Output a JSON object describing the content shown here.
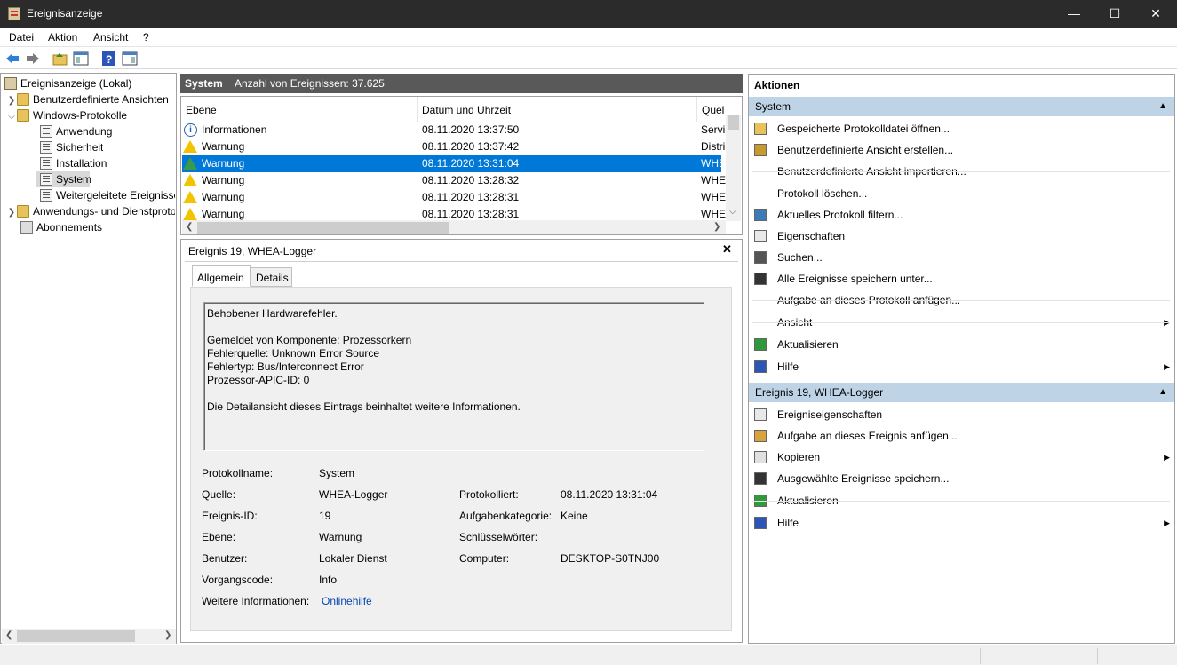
{
  "window": {
    "title": "Ereignisanzeige",
    "minimize": "—",
    "maximize": "☐",
    "close": "✕"
  },
  "menu": [
    "Datei",
    "Aktion",
    "Ansicht",
    "?"
  ],
  "tree": {
    "root": "Ereignisanzeige (Lokal)",
    "custom_views": "Benutzerdefinierte Ansichten",
    "windows_logs": "Windows-Protokolle",
    "logs": [
      "Anwendung",
      "Sicherheit",
      "Installation",
      "System",
      "Weitergeleitete Ereignisse"
    ],
    "app_service_logs": "Anwendungs- und Dienstprotokolle",
    "subscriptions": "Abonnements"
  },
  "list": {
    "header_title": "System",
    "header_count": "Anzahl von Ereignissen: 37.625",
    "columns": [
      "Ebene",
      "Datum und Uhrzeit",
      "Quel"
    ],
    "rows": [
      {
        "level": "Informationen",
        "icon": "info-icon",
        "date": "08.11.2020 13:37:50",
        "source": "Servi"
      },
      {
        "level": "Warnung",
        "icon": "warning-icon",
        "date": "08.11.2020 13:37:42",
        "source": "Distri"
      },
      {
        "level": "Warnung",
        "icon": "warning-icon",
        "date": "08.11.2020 13:31:04",
        "source": "WHE"
      },
      {
        "level": "Warnung",
        "icon": "warning-icon",
        "date": "08.11.2020 13:28:32",
        "source": "WHE"
      },
      {
        "level": "Warnung",
        "icon": "warning-icon",
        "date": "08.11.2020 13:28:31",
        "source": "WHE"
      },
      {
        "level": "Warnung",
        "icon": "warning-icon",
        "date": "08.11.2020 13:28:31",
        "source": "WHE"
      }
    ],
    "selected_index": 2
  },
  "detail": {
    "title": "Ereignis 19, WHEA-Logger",
    "close": "✕",
    "tabs": [
      "Allgemein",
      "Details"
    ],
    "message": "Behobener Hardwarefehler.\n\nGemeldet von Komponente: Prozessorkern\nFehlerquelle: Unknown Error Source\nFehlertyp: Bus/Interconnect Error\nProzessor-APIC-ID: 0\n\nDie Detailansicht dieses Eintrags beinhaltet weitere Informationen.",
    "fields": {
      "protokollname_label": "Protokollname:",
      "protokollname": "System",
      "quelle_label": "Quelle:",
      "quelle": "WHEA-Logger",
      "protokolliert_label": "Protokolliert:",
      "protokolliert": "08.11.2020 13:31:04",
      "ereignis_id_label": "Ereignis-ID:",
      "ereignis_id": "19",
      "aufgabenkategorie_label": "Aufgabenkategorie:",
      "aufgabenkategorie": "Keine",
      "ebene_label": "Ebene:",
      "ebene": "Warnung",
      "schluesselwoerter_label": "Schlüsselwörter:",
      "benutzer_label": "Benutzer:",
      "benutzer": "Lokaler Dienst",
      "computer_label": "Computer:",
      "computer": "DESKTOP-S0TNJ00",
      "vorgangscode_label": "Vorgangscode:",
      "vorgangscode": "Info",
      "weitere_label": "Weitere Informationen:",
      "weitere_link": "Onlinehilfe"
    }
  },
  "actions": {
    "title": "Aktionen",
    "section1": "System",
    "section1_items": [
      "Gespeicherte Protokolldatei öffnen...",
      "Benutzerdefinierte Ansicht erstellen...",
      "Benutzerdefinierte Ansicht importieren...",
      "Protokoll löschen...",
      "Aktuelles Protokoll filtern...",
      "Eigenschaften",
      "Suchen...",
      "Alle Ereignisse speichern unter...",
      "Aufgabe an dieses Protokoll anfügen...",
      "Ansicht",
      "Aktualisieren",
      "Hilfe"
    ],
    "section2": "Ereignis 19, WHEA-Logger",
    "section2_items": [
      "Ereigniseigenschaften",
      "Aufgabe an dieses Ereignis anfügen...",
      "Kopieren",
      "Ausgewählte Ereignisse speichern...",
      "Aktualisieren",
      "Hilfe"
    ]
  }
}
